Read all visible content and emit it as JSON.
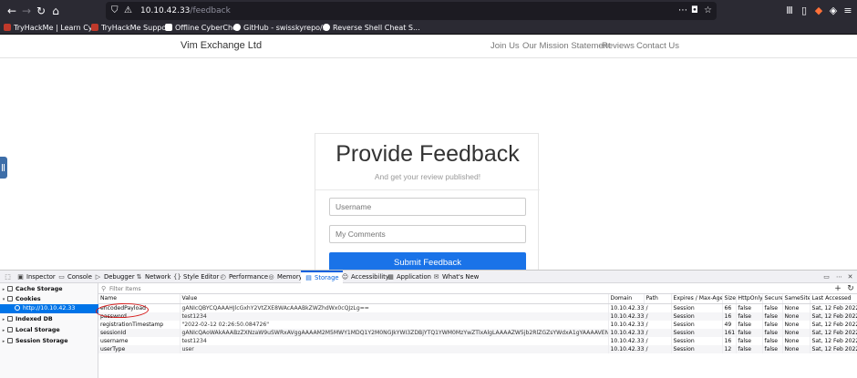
{
  "browser": {
    "url_host": "10.10.42.33",
    "url_path": "/feedback",
    "bookmarks": [
      {
        "label": "TryHackMe | Learn Cy...",
        "color": "#c0392b"
      },
      {
        "label": "TryHackMe Support",
        "color": "#c0392b"
      },
      {
        "label": "Offline CyberChef",
        "color": "#ffffff"
      },
      {
        "label": "GitHub - swisskyrepo/...",
        "color": "#ffffff"
      },
      {
        "label": "Reverse Shell Cheat S...",
        "color": "#ffffff"
      }
    ]
  },
  "site": {
    "brand": "Vim Exchange Ltd",
    "nav": [
      "Join Us",
      "Our Mission Statement",
      "Reviews",
      "Contact Us"
    ]
  },
  "feedback": {
    "title": "Provide Feedback",
    "subtitle": "And get your review published!",
    "username_placeholder": "Username",
    "comments_placeholder": "My Comments",
    "submit_label": "Submit Feedback"
  },
  "devtools": {
    "tabs": [
      "Inspector",
      "Console",
      "Debugger",
      "Network",
      "Style Editor",
      "Performance",
      "Memory",
      "Storage",
      "Accessibility",
      "Application",
      "What's New"
    ],
    "active_tab": "Storage",
    "tree": [
      {
        "label": "Cache Storage"
      },
      {
        "label": "Cookies"
      },
      {
        "label": "http://10.10.42.33"
      },
      {
        "label": "Indexed DB"
      },
      {
        "label": "Local Storage"
      },
      {
        "label": "Session Storage"
      }
    ],
    "filter_placeholder": "Filter Items",
    "columns": [
      "Name",
      "Value",
      "Domain",
      "Path",
      "Expires / Max-Age",
      "Size",
      "HttpOnly",
      "Secure",
      "SameSite",
      "Last Accessed"
    ],
    "rows": [
      [
        "encodedPayload",
        "gANIcQBYCQAAAHJlcGxhY2VtZXE8WAcAAABkZWZhdWx0cQJzLg==",
        "10.10.42.33",
        "/",
        "Session",
        "66",
        "false",
        "false",
        "None",
        "Sat, 12 Feb 2022 0..."
      ],
      [
        "password",
        "test1234",
        "10.10.42.33",
        "/",
        "Session",
        "16",
        "false",
        "false",
        "None",
        "Sat, 12 Feb 2022 0..."
      ],
      [
        "registrationTimestamp",
        "\"2022-02-12 02:26:50.084726\"",
        "10.10.42.33",
        "/",
        "Session",
        "49",
        "false",
        "false",
        "None",
        "Sat, 12 Feb 2022 0..."
      ],
      [
        "sessionId",
        "gANIcQAoWAkAAABzZXNzaW9uSWRxAVggAAAAM2M5MWY1MDQ1Y2M0NGJkYWI3ZDBjYTQ1YWM0MzYwZTlxAlgLAAAAZW5jb2RlZGZsYWdxA1gYAAAAVENNe2dvb2Rfb2xkX2Jhc2U2N...",
        "10.10.42.33",
        "/",
        "Session",
        "161",
        "false",
        "false",
        "None",
        "Sat, 12 Feb 2022 0..."
      ],
      [
        "username",
        "test1234",
        "10.10.42.33",
        "/",
        "Session",
        "16",
        "false",
        "false",
        "None",
        "Sat, 12 Feb 2022 0..."
      ],
      [
        "userType",
        "user",
        "10.10.42.33",
        "/",
        "Session",
        "12",
        "false",
        "false",
        "None",
        "Sat, 12 Feb 2022 0..."
      ]
    ]
  }
}
